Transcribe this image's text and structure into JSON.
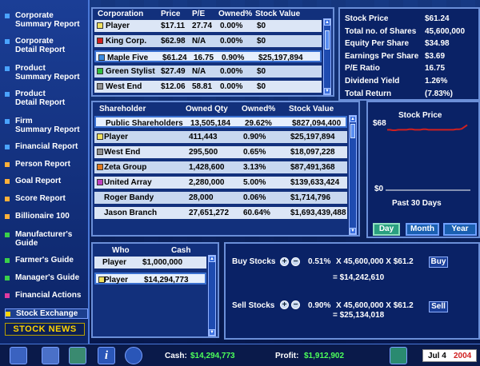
{
  "sidebar": {
    "items": [
      {
        "label": "Corporate\nSummary Report",
        "color": "#4aa3ff"
      },
      {
        "label": "Corporate\nDetail Report",
        "color": "#4aa3ff"
      },
      {
        "label": "Product\nSummary Report",
        "color": "#4aa3ff"
      },
      {
        "label": "Product\nDetail Report",
        "color": "#4aa3ff"
      },
      {
        "label": "Firm\nSummary Report",
        "color": "#4aa3ff"
      },
      {
        "label": "Financial Report",
        "color": "#4aa3ff"
      },
      {
        "label": "Person Report",
        "color": "#ffb03a"
      },
      {
        "label": "Goal Report",
        "color": "#ffb03a"
      },
      {
        "label": "Score Report",
        "color": "#ffb03a"
      },
      {
        "label": "Billionaire 100",
        "color": "#ffb03a"
      },
      {
        "label": "Manufacturer's\nGuide",
        "color": "#3ad04a"
      },
      {
        "label": "Farmer's Guide",
        "color": "#3ad04a"
      },
      {
        "label": "Manager's Guide",
        "color": "#3ad04a"
      },
      {
        "label": "Financial Actions",
        "color": "#e03aa0"
      },
      {
        "label": "Stock Exchange",
        "color": "#ffd400"
      }
    ],
    "stock_news": "STOCK NEWS"
  },
  "corp_table": {
    "headers": [
      "Corporation",
      "Price",
      "P/E",
      "Owned%",
      "Stock Value"
    ],
    "rows": [
      {
        "name": "Player",
        "price": "$17.11",
        "pe": "27.74",
        "owned": "0.00%",
        "value": "$0",
        "color": "#f0e060"
      },
      {
        "name": "King Corp.",
        "price": "$62.98",
        "pe": "N/A",
        "owned": "0.00%",
        "value": "$0",
        "color": "#d02020"
      },
      {
        "name": "Maple Five",
        "price": "$61.24",
        "pe": "16.75",
        "owned": "0.90%",
        "value": "$25,197,894",
        "color": "#3a8ae0"
      },
      {
        "name": "Green Stylist",
        "price": "$27.49",
        "pe": "N/A",
        "owned": "0.00%",
        "value": "$0",
        "color": "#30c040"
      },
      {
        "name": "West End",
        "price": "$12.06",
        "pe": "58.81",
        "owned": "0.00%",
        "value": "$0",
        "color": "#909090"
      }
    ]
  },
  "stats": {
    "rows": [
      {
        "label": "Stock Price",
        "value": "$61.24"
      },
      {
        "label": "Total no. of Shares",
        "value": "45,600,000"
      },
      {
        "label": "Equity Per Share",
        "value": "$34.98"
      },
      {
        "label": "Earnings Per Share",
        "value": "$3.69"
      },
      {
        "label": "P/E Ratio",
        "value": "16.75"
      },
      {
        "label": "Dividend Yield",
        "value": "1.26%"
      },
      {
        "label": "Total Return",
        "value": "(7.83%)"
      }
    ]
  },
  "shareholders": {
    "headers": [
      "Shareholder",
      "Owned Qty",
      "Owned%",
      "Stock Value"
    ],
    "rows": [
      {
        "name": "Public Shareholders",
        "qty": "13,505,184",
        "owned": "29.62%",
        "value": "$827,094,400",
        "color": ""
      },
      {
        "name": "Player",
        "qty": "411,443",
        "owned": "0.90%",
        "value": "$25,197,894",
        "color": "#f0e060"
      },
      {
        "name": "West End",
        "qty": "295,500",
        "owned": "0.65%",
        "value": "$18,097,228",
        "color": "#909090"
      },
      {
        "name": "Zeta Group",
        "qty": "1,428,600",
        "owned": "3.13%",
        "value": "$87,491,368",
        "color": "#e07a20"
      },
      {
        "name": "United Array",
        "qty": "2,280,000",
        "owned": "5.00%",
        "value": "$139,633,424",
        "color": "#c040c0"
      },
      {
        "name": "Roger Bandy",
        "qty": "28,000",
        "owned": "0.06%",
        "value": "$1,714,796",
        "color": ""
      },
      {
        "name": "Jason Branch",
        "qty": "27,651,272",
        "owned": "60.64%",
        "value": "$1,693,439,488",
        "color": ""
      }
    ]
  },
  "chart": {
    "title": "Stock Price",
    "top_label": "$68",
    "bottom_label": "$0",
    "caption": "Past 30 Days",
    "buttons": [
      "Day",
      "Month",
      "Year"
    ]
  },
  "chart_data": {
    "type": "line",
    "title": "Stock Price",
    "xlabel": "Past 30 Days",
    "ylabel": "",
    "ylim": [
      0,
      68
    ],
    "x": [
      1,
      2,
      3,
      4,
      5,
      6,
      7,
      8,
      9,
      10,
      11,
      12,
      13,
      14,
      15,
      16,
      17,
      18,
      19,
      20,
      21,
      22,
      23,
      24,
      25,
      26,
      27,
      28,
      29,
      30
    ],
    "series": [
      {
        "name": "",
        "values": [
          61,
          61,
          60.5,
          60.5,
          61,
          61,
          61,
          61,
          61.5,
          61.5,
          61,
          61,
          61,
          61.5,
          61.5,
          61,
          61,
          61,
          61,
          61,
          61,
          61,
          61,
          61,
          61,
          61.5,
          61.5,
          62,
          64,
          66
        ]
      }
    ],
    "color": "#d02020",
    "grid": false
  },
  "cash_table": {
    "headers": [
      "Who",
      "Cash"
    ],
    "rows": [
      {
        "who": "Player",
        "cash": "$1,000,000",
        "color": ""
      },
      {
        "who": "Player",
        "cash": "$14,294,773",
        "color": "#f0e060"
      }
    ]
  },
  "buy": {
    "label": "Buy Stocks",
    "pct": "0.51%",
    "formula": "X 45,600,000 X $61.2",
    "result": "= $14,242,610",
    "button": "Buy"
  },
  "sell": {
    "label": "Sell Stocks",
    "pct": "0.90%",
    "formula": "X 45,600,000 X $61.2",
    "result": "= $25,134,018",
    "button": "Sell"
  },
  "bottom": {
    "cash_label": "Cash:",
    "cash": "$14,294,773",
    "profit_label": "Profit:",
    "profit": "$1,912,902",
    "date": "Jul 4",
    "year": "2004"
  }
}
